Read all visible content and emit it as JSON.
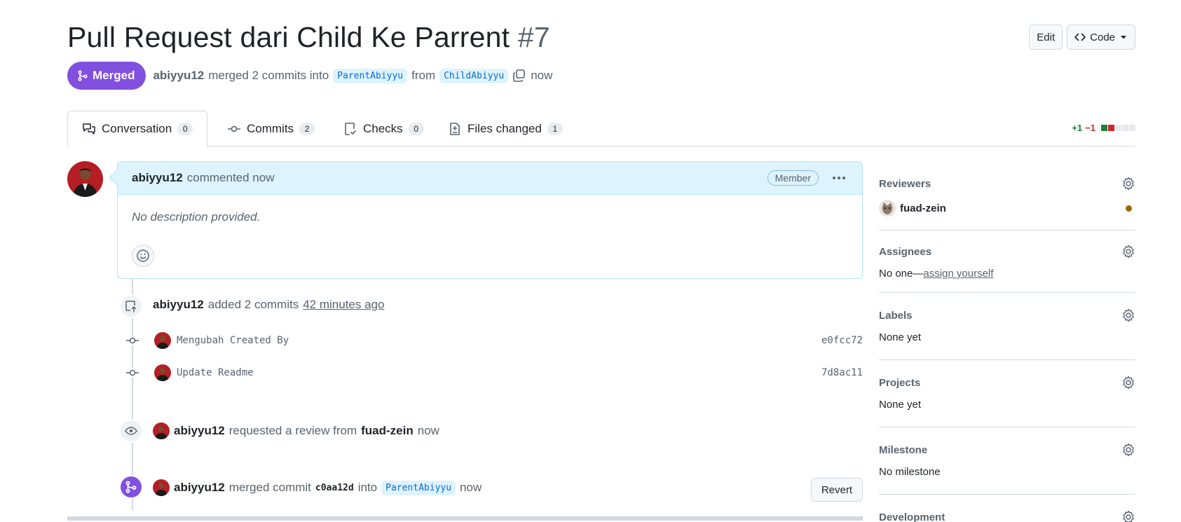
{
  "pr": {
    "title": "Pull Request dari Child Ke Parrent",
    "number": "#7",
    "state": "Merged",
    "author": "abiyyu12",
    "merged_text": "merged 2 commits into",
    "base_branch": "ParentAbiyyu",
    "from_text": "from",
    "head_branch": "ChildAbiyyu",
    "time": "now"
  },
  "header_actions": {
    "edit_label": "Edit",
    "code_label": "Code"
  },
  "tabs": [
    {
      "label": "Conversation",
      "count": "0"
    },
    {
      "label": "Commits",
      "count": "2"
    },
    {
      "label": "Checks",
      "count": "0"
    },
    {
      "label": "Files changed",
      "count": "1"
    }
  ],
  "diffstat": {
    "additions": "+1",
    "deletions": "−1"
  },
  "comment": {
    "author": "abiyyu12",
    "action": "commented now",
    "role": "Member",
    "body": "No description provided."
  },
  "timeline": {
    "commits_event": {
      "author": "abiyyu12",
      "text": "added 2 commits",
      "time": "42 minutes ago"
    },
    "commits": [
      {
        "message": "Mengubah Created By",
        "sha": "e0fcc72"
      },
      {
        "message": "Update Readme",
        "sha": "7d8ac11"
      }
    ],
    "review_event": {
      "author": "abiyyu12",
      "text": "requested a review from",
      "reviewer": "fuad-zein",
      "time": "now"
    },
    "merge_event": {
      "author": "abiyyu12",
      "text": "merged commit",
      "sha": "c0aa12d",
      "into": "into",
      "branch": "ParentAbiyyu",
      "time": "now",
      "revert_label": "Revert"
    }
  },
  "sidebar": {
    "reviewers": {
      "title": "Reviewers",
      "name": "fuad-zein"
    },
    "assignees": {
      "title": "Assignees",
      "value": "No one—",
      "link": "assign yourself"
    },
    "labels": {
      "title": "Labels",
      "value": "None yet"
    },
    "projects": {
      "title": "Projects",
      "value": "None yet"
    },
    "milestone": {
      "title": "Milestone",
      "value": "No milestone"
    },
    "development": {
      "title": "Development"
    }
  },
  "colors": {
    "merged": "#8250df",
    "accent": "#0969da",
    "added": "#1a7f37",
    "deleted": "#d1242f",
    "pending": "#9a6700"
  }
}
